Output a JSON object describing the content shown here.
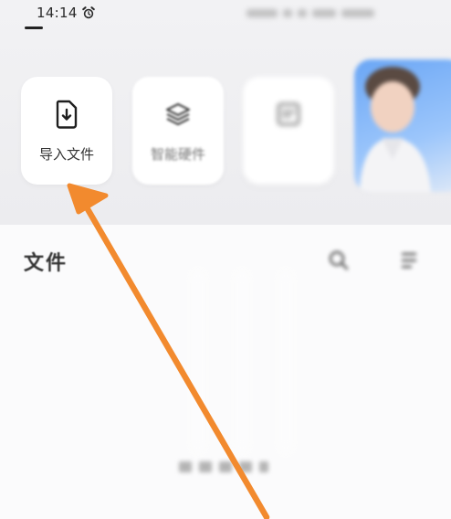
{
  "status_bar": {
    "time": "14:14",
    "alarm_icon": "alarm-clock-icon"
  },
  "quick_actions": [
    {
      "label": "导入文件",
      "icon": "file-import-icon"
    },
    {
      "label": "智能硬件",
      "icon": "layers-icon"
    },
    {
      "label": "",
      "icon": "scan-icon"
    },
    {
      "label": "",
      "icon": "promo-banner"
    }
  ],
  "files": {
    "title": "文件",
    "search_icon": "search-icon",
    "more_icon": "more-icon"
  },
  "annotation": {
    "arrow_color": "#f28a2e",
    "target": "导入文件"
  },
  "colors": {
    "background": "#f7f7f8",
    "card": "#ffffff",
    "arrow": "#f28a2e"
  }
}
